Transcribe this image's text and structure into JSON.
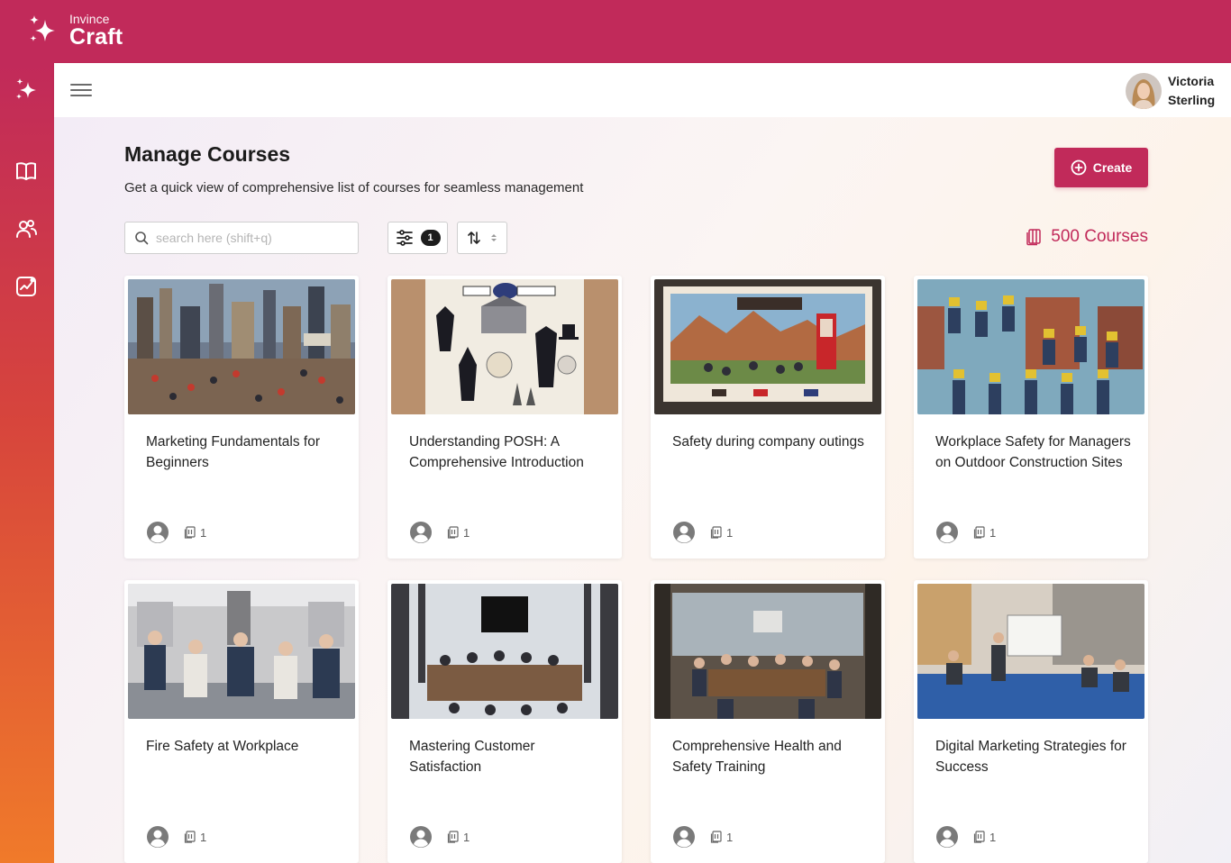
{
  "brand": {
    "small": "Invince",
    "big": "Craft"
  },
  "sidebar": {
    "items": [
      {
        "name": "sparkles-icon"
      },
      {
        "name": "book-icon"
      },
      {
        "name": "users-icon"
      },
      {
        "name": "analytics-icon"
      }
    ]
  },
  "header": {
    "user": {
      "first_name": "Victoria",
      "last_name": "Sterling"
    }
  },
  "page": {
    "title": "Manage Courses",
    "subtitle": "Get a quick view of comprehensive list of courses for seamless management",
    "create_label": "Create",
    "search_placeholder": "search here (shift+q)",
    "filter_count": "1",
    "course_count": "500 Courses"
  },
  "colors": {
    "brand": "#c12a5a",
    "sidebar_bottom": "#f07a2a"
  },
  "courses": [
    {
      "title": "Marketing Fundamentals for Beginners",
      "docs": "1"
    },
    {
      "title": "Understanding POSH: A Comprehensive Introduction",
      "docs": "1"
    },
    {
      "title": "Safety during company outings",
      "docs": "1"
    },
    {
      "title": "Workplace Safety for Managers on Outdoor Construction Sites",
      "docs": "1"
    },
    {
      "title": "Fire Safety at Workplace",
      "docs": "1"
    },
    {
      "title": "Mastering Customer Satisfaction",
      "docs": "1"
    },
    {
      "title": "Comprehensive Health and Safety Training",
      "docs": "1"
    },
    {
      "title": "Digital Marketing Strategies for Success",
      "docs": "1"
    }
  ]
}
